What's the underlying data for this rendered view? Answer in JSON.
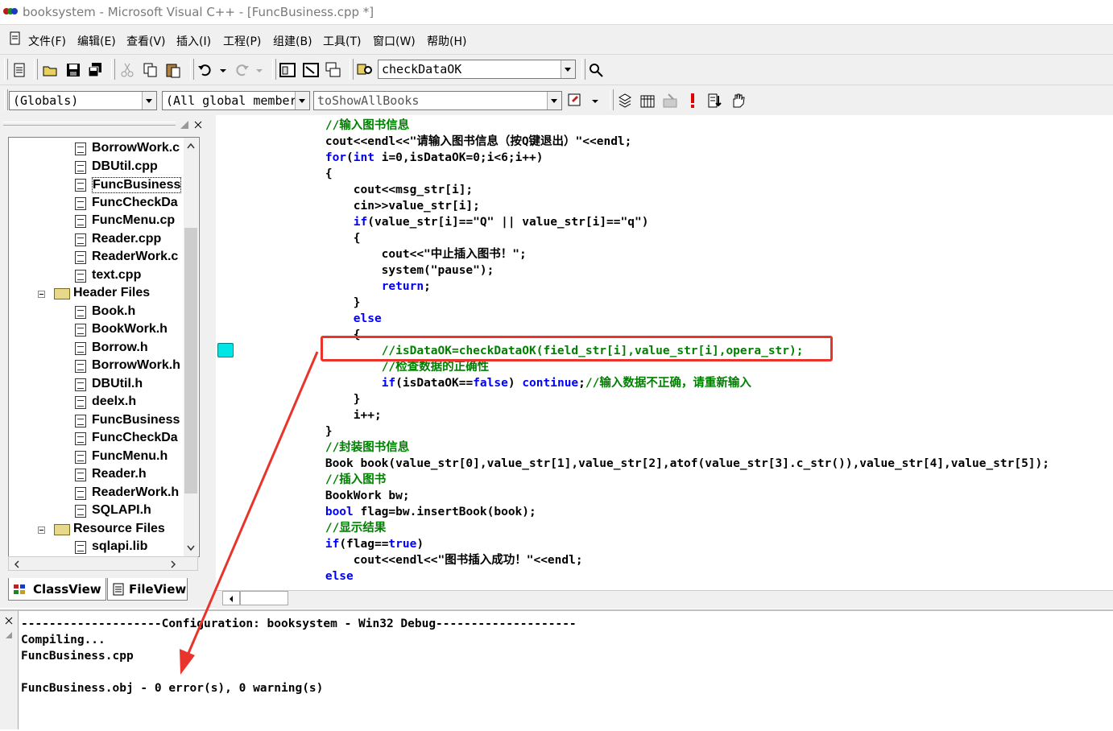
{
  "window": {
    "title": "booksystem - Microsoft Visual C++ - [FuncBusiness.cpp *]"
  },
  "menu": {
    "items": [
      "文件(F)",
      "编辑(E)",
      "查看(V)",
      "插入(I)",
      "工程(P)",
      "组建(B)",
      "工具(T)",
      "窗口(W)",
      "帮助(H)"
    ]
  },
  "toolbar": {
    "find_combo_value": "checkDataOK"
  },
  "wizardbar": {
    "class_combo": "(Globals)",
    "filter_combo": "(All global members",
    "members_combo": "toShowAllBooks"
  },
  "workspace": {
    "files": [
      {
        "label": "BorrowWork.c",
        "type": "file",
        "depth": 2
      },
      {
        "label": "DBUtil.cpp",
        "type": "file",
        "depth": 2
      },
      {
        "label": "FuncBusiness",
        "type": "file",
        "depth": 2
      },
      {
        "label": "FuncCheckDa",
        "type": "file",
        "depth": 2
      },
      {
        "label": "FuncMenu.cp",
        "type": "file",
        "depth": 2
      },
      {
        "label": "Reader.cpp",
        "type": "file",
        "depth": 2
      },
      {
        "label": "ReaderWork.c",
        "type": "file",
        "depth": 2
      },
      {
        "label": "text.cpp",
        "type": "file",
        "depth": 2
      },
      {
        "label": "Header Files",
        "type": "folder",
        "depth": 1
      },
      {
        "label": "Book.h",
        "type": "file",
        "depth": 2
      },
      {
        "label": "BookWork.h",
        "type": "file",
        "depth": 2
      },
      {
        "label": "Borrow.h",
        "type": "file",
        "depth": 2
      },
      {
        "label": "BorrowWork.h",
        "type": "file",
        "depth": 2
      },
      {
        "label": "DBUtil.h",
        "type": "file",
        "depth": 2
      },
      {
        "label": "deelx.h",
        "type": "file",
        "depth": 2
      },
      {
        "label": "FuncBusiness",
        "type": "file",
        "depth": 2
      },
      {
        "label": "FuncCheckDa",
        "type": "file",
        "depth": 2
      },
      {
        "label": "FuncMenu.h",
        "type": "file",
        "depth": 2
      },
      {
        "label": "Reader.h",
        "type": "file",
        "depth": 2
      },
      {
        "label": "ReaderWork.h",
        "type": "file",
        "depth": 2
      },
      {
        "label": "SQLAPI.h",
        "type": "file",
        "depth": 2
      },
      {
        "label": "Resource Files",
        "type": "folder",
        "depth": 1
      },
      {
        "label": "sqlapi.lib",
        "type": "file",
        "depth": 2
      }
    ],
    "tabs": [
      "ClassView",
      "FileView"
    ]
  },
  "editor": {
    "lines": [
      [
        {
          "t": "        "
        },
        {
          "t": "//输入图书信息",
          "c": "cm"
        }
      ],
      [
        {
          "t": "        cout<<endl<<\"请输入图书信息（按Q键退出）\"<<endl;"
        }
      ],
      [
        {
          "t": "        "
        },
        {
          "t": "for",
          "c": "kw"
        },
        {
          "t": "("
        },
        {
          "t": "int",
          "c": "kw"
        },
        {
          "t": " i=0,isDataOK=0;i<6;i++)"
        }
      ],
      [
        {
          "t": "        {"
        }
      ],
      [
        {
          "t": "            cout<<msg_str[i];"
        }
      ],
      [
        {
          "t": "            cin>>value_str[i];"
        }
      ],
      [
        {
          "t": "            "
        },
        {
          "t": "if",
          "c": "kw"
        },
        {
          "t": "(value_str[i]==\"Q\" || value_str[i]==\"q\")"
        }
      ],
      [
        {
          "t": "            {"
        }
      ],
      [
        {
          "t": "                cout<<\"中止插入图书！\";"
        }
      ],
      [
        {
          "t": "                system(\"pause\");"
        }
      ],
      [
        {
          "t": "                "
        },
        {
          "t": "return",
          "c": "kw"
        },
        {
          "t": ";"
        }
      ],
      [
        {
          "t": "            }"
        }
      ],
      [
        {
          "t": "            "
        },
        {
          "t": "else",
          "c": "kw"
        }
      ],
      [
        {
          "t": "            {"
        }
      ],
      [
        {
          "t": "                "
        },
        {
          "t": "//isDataOK=checkDataOK(field_str[i],value_str[i],opera_str);",
          "c": "cm"
        }
      ],
      [
        {
          "t": "                "
        },
        {
          "t": "//检查数据的正确性",
          "c": "cm"
        }
      ],
      [
        {
          "t": "                "
        },
        {
          "t": "if",
          "c": "kw"
        },
        {
          "t": "(isDataOK=="
        },
        {
          "t": "false",
          "c": "kw"
        },
        {
          "t": ") "
        },
        {
          "t": "continue",
          "c": "kw"
        },
        {
          "t": ";"
        },
        {
          "t": "//输入数据不正确，请重新输入",
          "c": "cm"
        }
      ],
      [
        {
          "t": "            }"
        }
      ],
      [
        {
          "t": "            i++;"
        }
      ],
      [
        {
          "t": "        }"
        }
      ],
      [
        {
          "t": "        "
        },
        {
          "t": "//封装图书信息",
          "c": "cm"
        }
      ],
      [
        {
          "t": "        Book book(value_str[0],value_str[1],value_str[2],atof(value_str[3].c_str()),value_str[4],value_str[5]);"
        }
      ],
      [
        {
          "t": "        "
        },
        {
          "t": "//插入图书",
          "c": "cm"
        }
      ],
      [
        {
          "t": "        BookWork bw;"
        }
      ],
      [
        {
          "t": "        "
        },
        {
          "t": "bool",
          "c": "kw"
        },
        {
          "t": " flag=bw.insertBook(book);"
        }
      ],
      [
        {
          "t": "        "
        },
        {
          "t": "//显示结果",
          "c": "cm"
        }
      ],
      [
        {
          "t": "        "
        },
        {
          "t": "if",
          "c": "kw"
        },
        {
          "t": "(flag=="
        },
        {
          "t": "true",
          "c": "kw"
        },
        {
          "t": ")"
        }
      ],
      [
        {
          "t": "            cout<<endl<<\"图书插入成功！\"<<endl;"
        }
      ],
      [
        {
          "t": "        "
        },
        {
          "t": "else",
          "c": "kw"
        }
      ]
    ]
  },
  "output": {
    "lines": [
      "--------------------Configuration: booksystem - Win32 Debug--------------------",
      "Compiling...",
      "FuncBusiness.cpp",
      "",
      "FuncBusiness.obj - 0 error(s), 0 warning(s)"
    ]
  },
  "annotation": {
    "color": "#e8342a"
  },
  "colors": {
    "keyword": "#0000ff",
    "comment": "#008000",
    "bookmark": "#00e5e5"
  }
}
